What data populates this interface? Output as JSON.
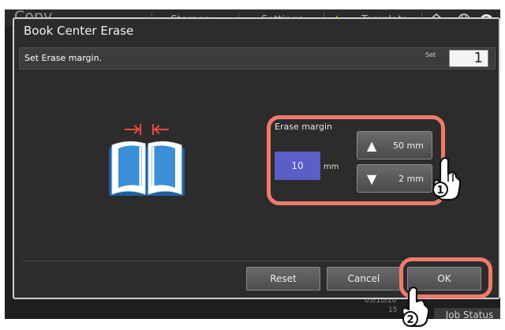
{
  "topbar": {
    "app": "Copy",
    "tabs": [
      "Storage",
      "Settings",
      "Template"
    ],
    "icons": [
      "star-icon",
      "home-icon",
      "globe-icon",
      "help-icon"
    ]
  },
  "dialog": {
    "title": "Book Center Erase",
    "message": "Set Erase margin.",
    "set_label": "Set",
    "set_value": "1"
  },
  "erase": {
    "label": "Erase margin",
    "value": "10",
    "unit": "mm",
    "up_label": "50 mm",
    "down_label": "2 mm"
  },
  "buttons": {
    "reset": "Reset",
    "cancel": "Cancel",
    "ok": "OK"
  },
  "background": {
    "date": "05/10/20",
    "time": "15",
    "job_status": "Job Status"
  },
  "callouts": [
    "1",
    "2"
  ],
  "colors": {
    "highlight": "#ef7a6a",
    "value_box": "#5b5ec7",
    "arrow_red": "#e84a3c",
    "book_blue": "#3a8fd8"
  }
}
